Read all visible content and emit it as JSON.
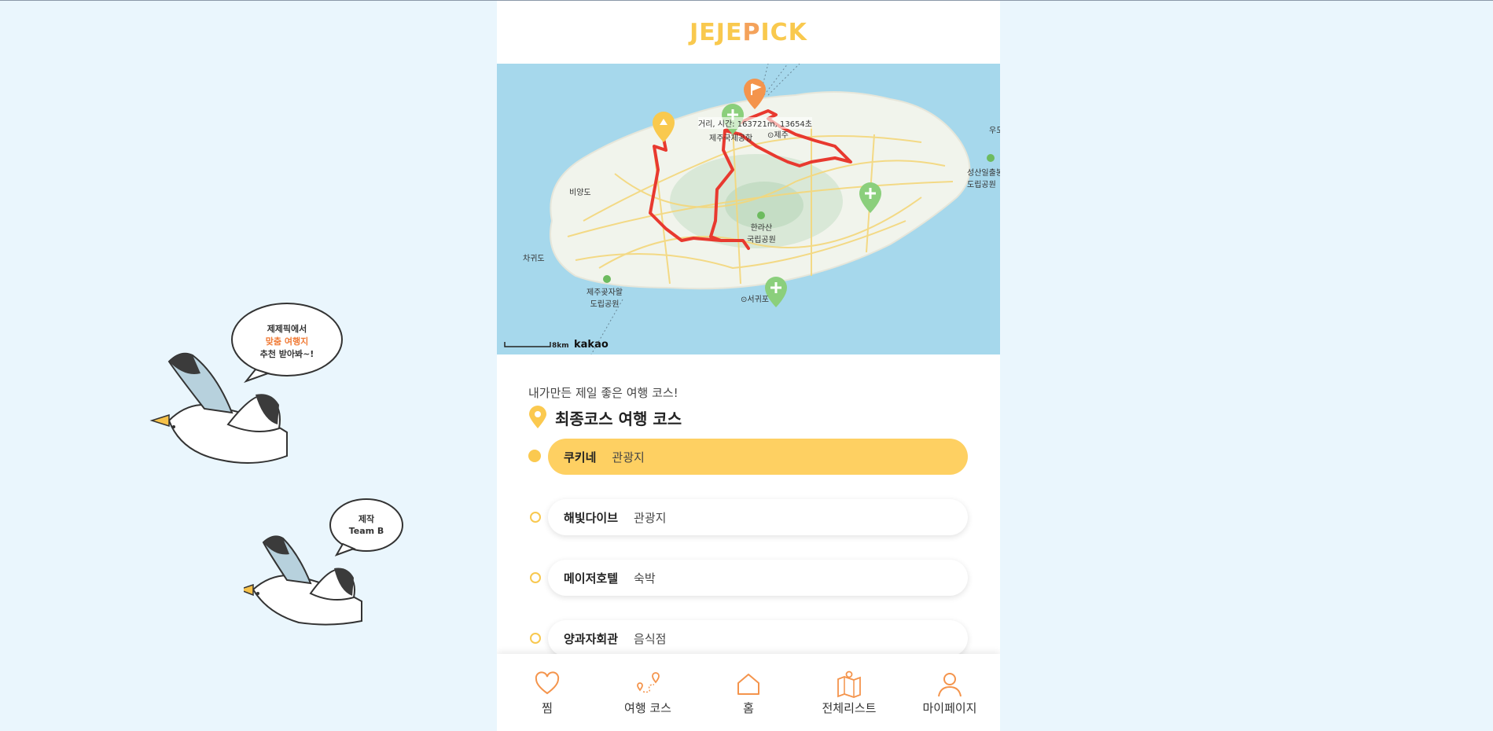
{
  "app": {
    "logo": "JEJEPICK",
    "logo_parts": [
      "JEJE",
      "P",
      "ICK"
    ]
  },
  "decoration": {
    "bubble1": [
      "제제픽에서",
      "맞춤 여행지",
      "추천 받아봐~!"
    ],
    "bubble2": [
      "제작",
      "Team B"
    ]
  },
  "map": {
    "info": "거리, 시간: 163721m, 13654초",
    "labels": {
      "airport": "제주국제공항",
      "jeju": "⊙제주",
      "biyangdo": "비양도",
      "chagwido": "차귀도",
      "hallasan": "한라산\n국립공원",
      "gotjawal": "제주곶자왈\n도립공원",
      "seogwipo": "⊙서귀포",
      "seongsan": "성산일출봉\n도립공원",
      "udo": "우도"
    },
    "scale": "8km",
    "provider": "kakao"
  },
  "course": {
    "subtitle": "내가만든 제일 좋은 여행 코스!",
    "title": "최종코스 여행 코스",
    "items": [
      {
        "name": "쿠키네",
        "category": "관광지",
        "active": true
      },
      {
        "name": "해빛다이브",
        "category": "관광지",
        "active": false
      },
      {
        "name": "메이저호텔",
        "category": "숙박",
        "active": false
      },
      {
        "name": "양과자회관",
        "category": "음식점",
        "active": false
      }
    ]
  },
  "tabs": [
    {
      "label": "찜",
      "icon": "heart-icon"
    },
    {
      "label": "여행 코스",
      "icon": "route-icon"
    },
    {
      "label": "홈",
      "icon": "home-icon"
    },
    {
      "label": "전체리스트",
      "icon": "map-list-icon"
    },
    {
      "label": "마이페이지",
      "icon": "user-icon"
    }
  ],
  "colors": {
    "accent": "#fed062",
    "route": "#e8392f",
    "tab_icon": "#f4a25b"
  }
}
